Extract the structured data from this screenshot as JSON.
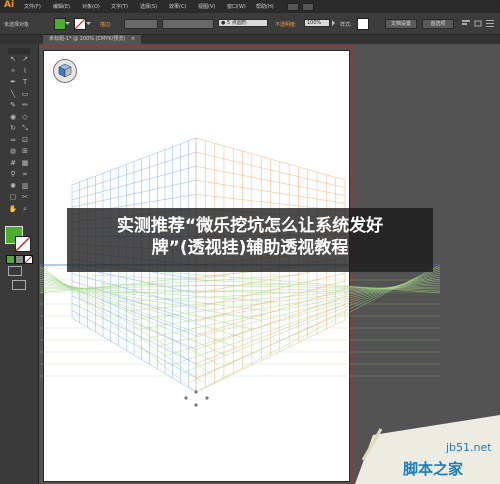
{
  "app": {
    "logo": "Ai"
  },
  "menu": [
    "文件(F)",
    "编辑(E)",
    "对象(O)",
    "文字(T)",
    "选择(S)",
    "效果(C)",
    "视图(V)",
    "窗口(W)",
    "帮助(H)"
  ],
  "control_bar": {
    "selection_label": "未选择对象",
    "stroke_label": "描边:",
    "stroke_weight": "",
    "brush_value": "5 点圆形",
    "opacity_label": "不透明度:",
    "opacity_value": "100%",
    "style_label": "样式:",
    "doc_setup_button": "文档设置",
    "preferences_button": "首选项",
    "colors": {
      "fill": "#4caf2a",
      "stroke": "#ffffff"
    }
  },
  "document_tab": {
    "title": "未标题-1* @ 100% (CMYK/预览)",
    "close": "×"
  },
  "overlay": {
    "line1": "实测推荐“微乐挖坑怎么让系统发好",
    "line2": "牌”(透视挂)辅助透视教程"
  },
  "watermark": {
    "site": "jb51.net",
    "name": "脚本之家"
  },
  "colors": {
    "grid_left": "#7aa7e6",
    "grid_right": "#f0a86a",
    "grid_floor": "#a6d68c",
    "horizon": "#2e6fd0"
  }
}
